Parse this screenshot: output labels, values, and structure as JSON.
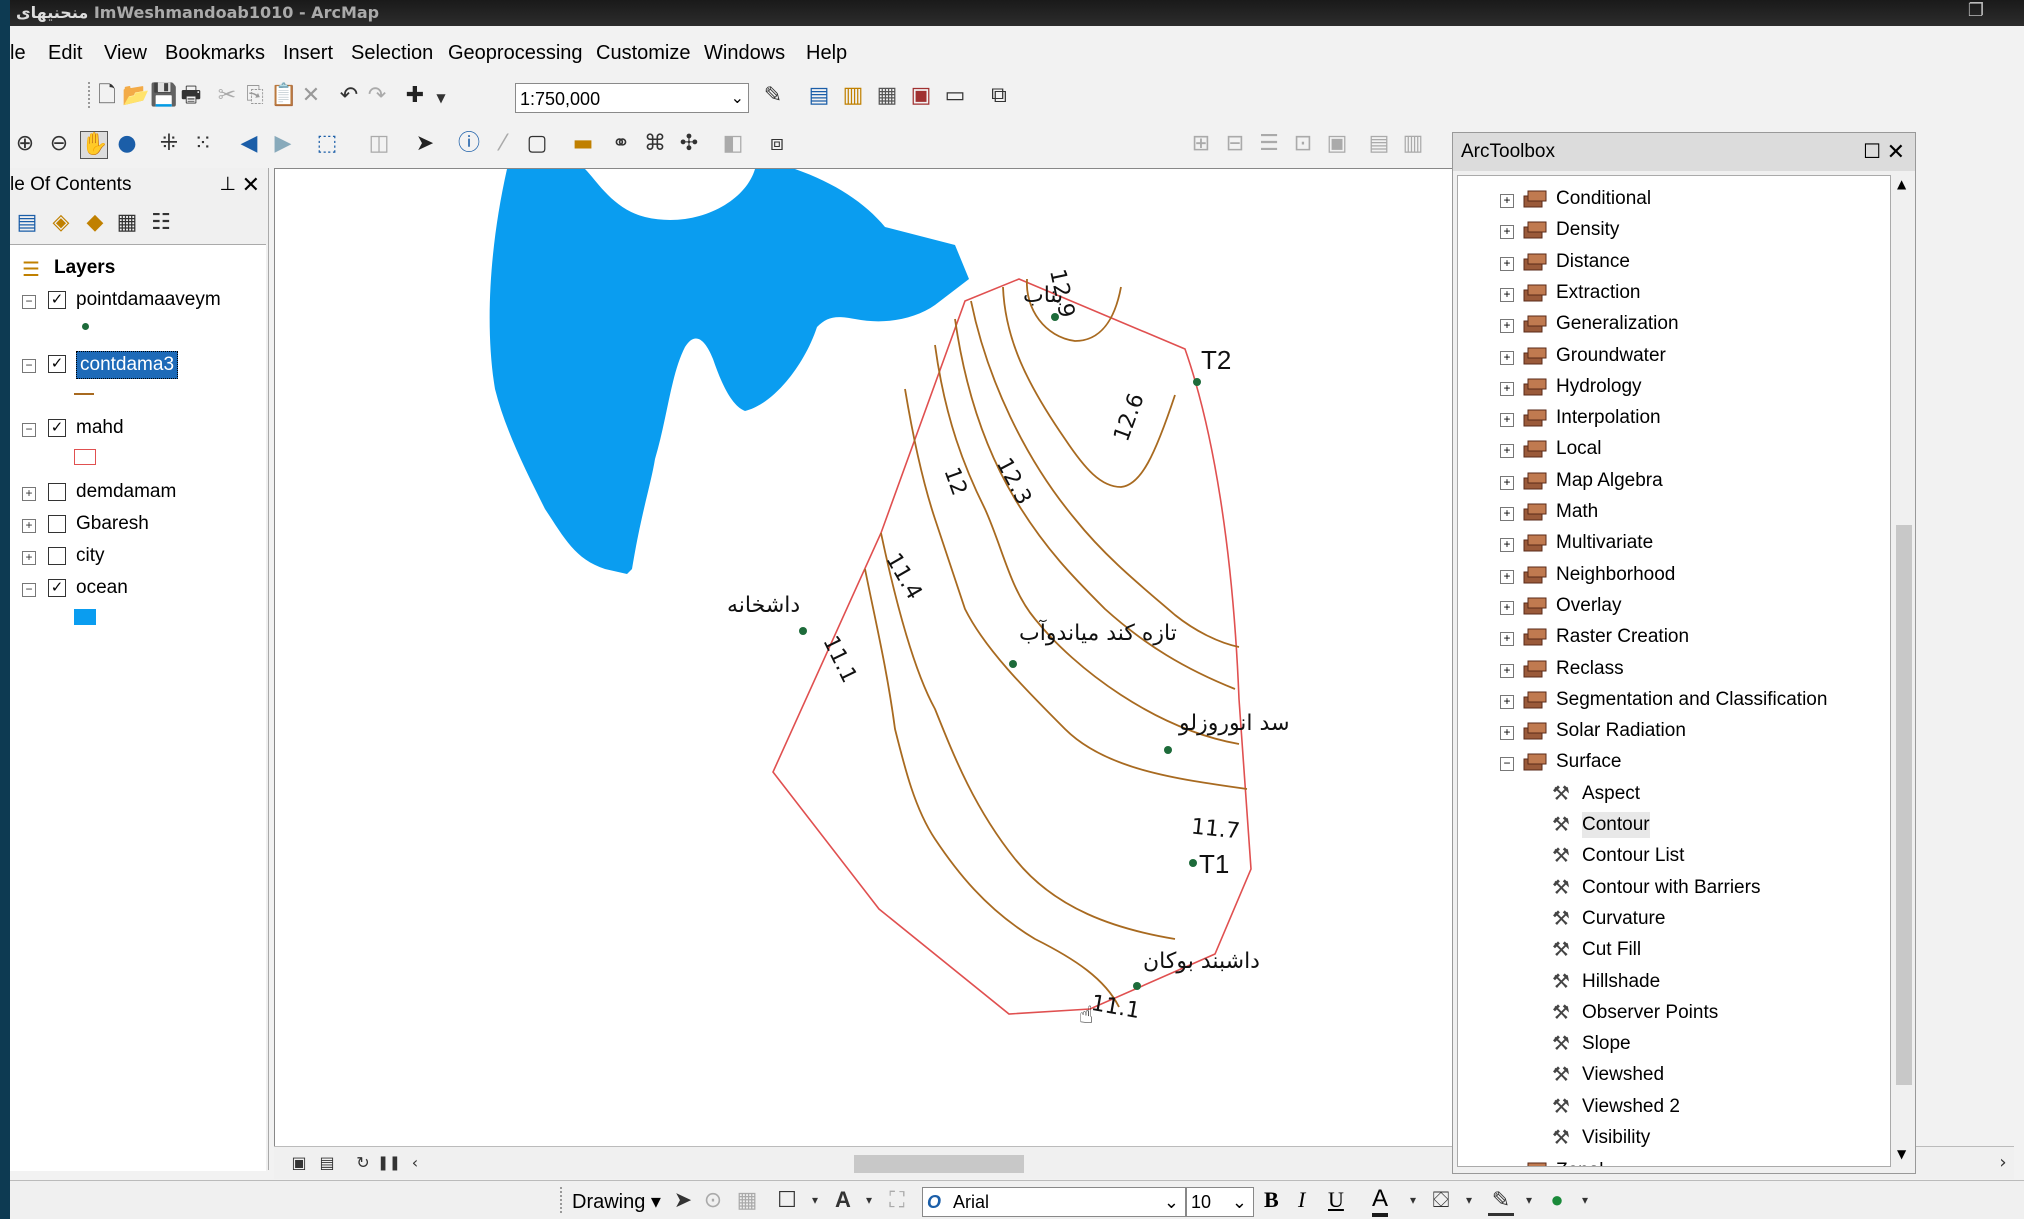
{
  "window": {
    "title": "ImWeshmandoab1010 - ArcMap",
    "title_overlay": "منحنيهاى"
  },
  "menu": [
    "le",
    "Edit",
    "View",
    "Bookmarks",
    "Insert",
    "Selection",
    "Geoprocessing",
    "Customize",
    "Windows",
    "Help"
  ],
  "toolbar": {
    "scale_value": "1:750,000"
  },
  "toc": {
    "title": "le Of Contents",
    "root_label": "Layers",
    "layers": [
      {
        "name": "pointdamaaveym",
        "checked": true,
        "expanded": true,
        "selected": false,
        "symbol": "point-green"
      },
      {
        "name": "contdama3",
        "checked": true,
        "expanded": true,
        "selected": true,
        "symbol": "line-orange"
      },
      {
        "name": "mahd",
        "checked": true,
        "expanded": true,
        "selected": false,
        "symbol": "poly-red-outline"
      },
      {
        "name": "demdamam",
        "checked": false,
        "expanded": false,
        "selected": false
      },
      {
        "name": "Gbaresh",
        "checked": false,
        "expanded": false,
        "selected": false
      },
      {
        "name": "city",
        "checked": false,
        "expanded": false,
        "selected": false
      },
      {
        "name": "ocean",
        "checked": true,
        "expanded": true,
        "selected": false,
        "symbol": "fill-blue"
      }
    ]
  },
  "map": {
    "contour_labels": [
      "12.9",
      "12.6",
      "12",
      "12.3",
      "11.4",
      "11.1",
      "11.7",
      "11.1"
    ],
    "station_labels": [
      "بناب",
      "T2",
      "داشخانه",
      "تازه کند میاندوآب",
      "سد انوروزلو",
      "T1",
      "داشبند بوکان"
    ],
    "colors": {
      "water": "#0a9df0",
      "boundary": "#e05050",
      "contour": "#a86a20",
      "point": "#1d6b3a"
    }
  },
  "arctoolbox": {
    "title": "ArcToolbox",
    "toolsets": [
      "Conditional",
      "Density",
      "Distance",
      "Extraction",
      "Generalization",
      "Groundwater",
      "Hydrology",
      "Interpolation",
      "Local",
      "Map Algebra",
      "Math",
      "Multivariate",
      "Neighborhood",
      "Overlay",
      "Raster Creation",
      "Reclass",
      "Segmentation and Classification",
      "Solar Radiation",
      "Surface"
    ],
    "surface_tools": [
      "Aspect",
      "Contour",
      "Contour List",
      "Contour with Barriers",
      "Curvature",
      "Cut Fill",
      "Hillshade",
      "Observer Points",
      "Slope",
      "Viewshed",
      "Viewshed 2",
      "Visibility"
    ],
    "highlighted_tool": "Contour",
    "next_toolset": "Zonal"
  },
  "drawing_toolbar": {
    "label": "Drawing",
    "font": "Arial",
    "size": "10",
    "bold": "B",
    "italic": "I",
    "underline": "U",
    "font_color": "A"
  }
}
